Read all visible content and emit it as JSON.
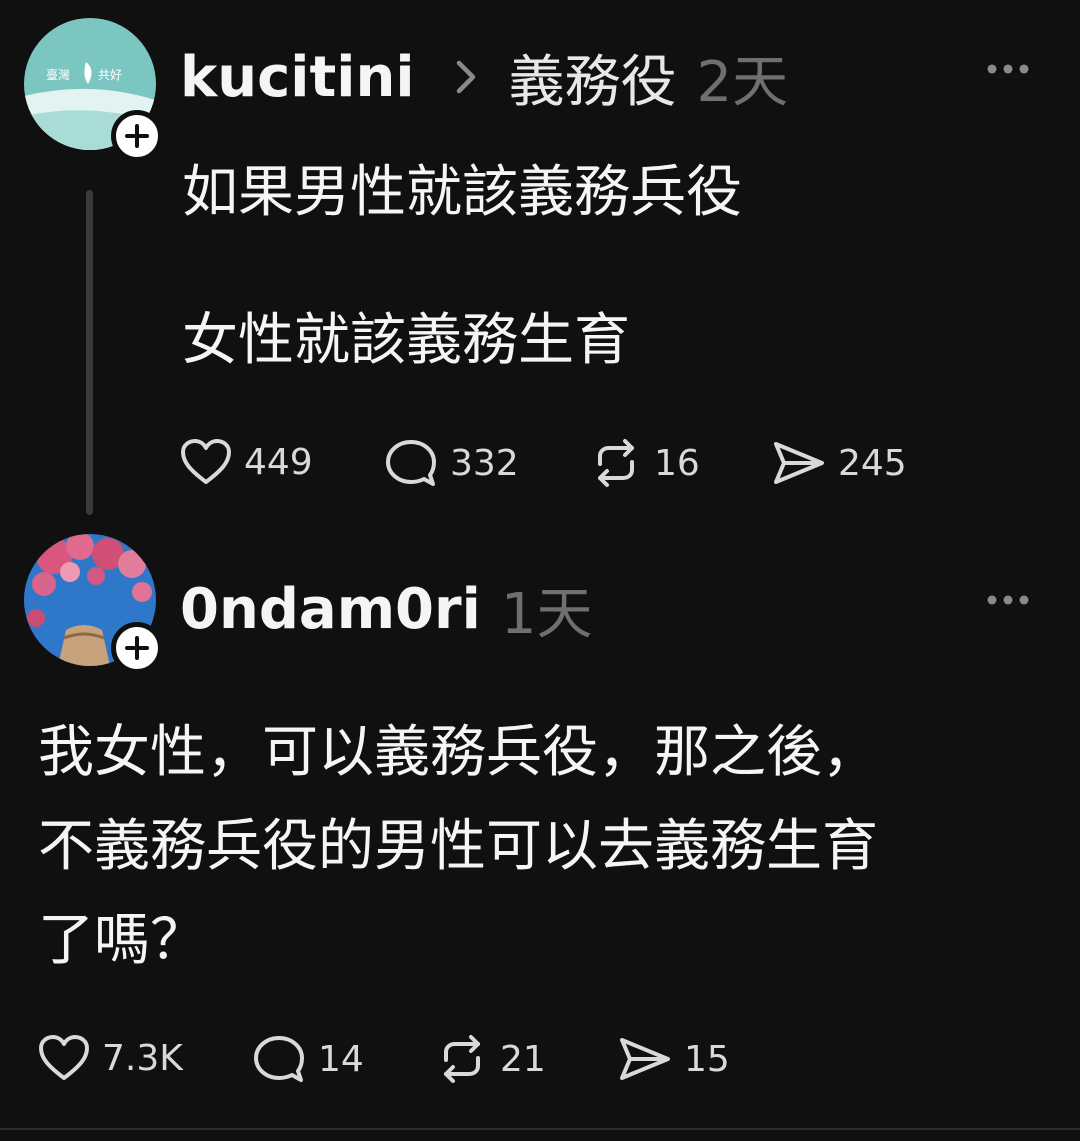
{
  "thread": {
    "posts": [
      {
        "username": "kucitini",
        "topic": "義務役",
        "timestamp": "2天",
        "avatar_text_left": "臺灣",
        "avatar_text_right": "共好",
        "avatar_icon": "taiwan-logo-avatar",
        "text_lines": [
          "如果男性就該義務兵役",
          "",
          "女性就該義務生育"
        ],
        "stats": {
          "likes": "449",
          "replies": "332",
          "reposts": "16",
          "shares": "245"
        }
      },
      {
        "username": "0ndam0ri",
        "timestamp": "1天",
        "avatar_icon": "cherry-blossom-avatar",
        "text_lines": [
          "我女性，可以義務兵役，那之後，",
          "不義務兵役的男性可以去義務生育",
          "了嗎？"
        ],
        "stats": {
          "likes": "7.3K",
          "replies": "14",
          "reposts": "21",
          "shares": "15"
        }
      }
    ]
  },
  "icons": {
    "follow": "plus-icon",
    "topic_separator": "chevron-right-icon",
    "more": "more-options-icon",
    "like": "heart-icon",
    "reply": "comment-icon",
    "repost": "repost-icon",
    "share": "send-icon"
  },
  "colors": {
    "background": "#101010",
    "text_primary": "#f3f5f7",
    "text_secondary": "#6f6f6f",
    "thread_line": "#3a3a3a",
    "avatar1_teal": "#6fc1bd"
  }
}
